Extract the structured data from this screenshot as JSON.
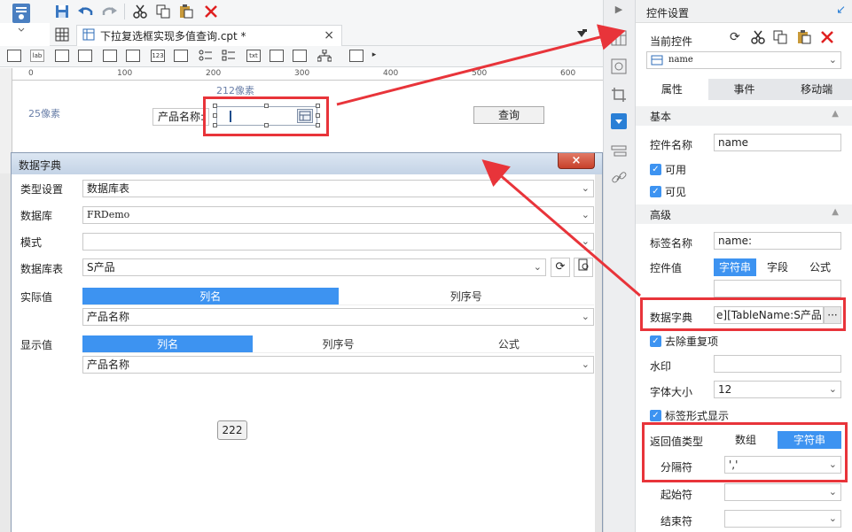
{
  "toolbar": {
    "icons": [
      "save-icon",
      "undo-icon",
      "redo-icon",
      "cut-icon",
      "copy-icon",
      "paste-icon",
      "delete-icon"
    ]
  },
  "tab": {
    "title": "下拉复选框实现多值查询.cpt *",
    "close": "×"
  },
  "widget_bar": {
    "items": [
      "lab",
      "123",
      "txt"
    ]
  },
  "ruler": {
    "marks": [
      "0",
      "100",
      "200",
      "300",
      "400",
      "500",
      "600"
    ]
  },
  "canvas": {
    "width_label": "212像素",
    "height_label": "25像素",
    "field_label": "产品名称:",
    "query_button": "查询"
  },
  "dialog": {
    "title": "数据字典",
    "close": "×",
    "type_label": "类型设置",
    "type_value": "数据库表",
    "db_label": "数据库",
    "db_value": "FRDemo",
    "schema_label": "模式",
    "schema_value": "",
    "table_label": "数据库表",
    "table_value": "S产品",
    "actual_label": "实际值",
    "actual_tabs": [
      "列名",
      "列序号"
    ],
    "actual_value": "产品名称",
    "display_label": "显示值",
    "display_tabs": [
      "列名",
      "列序号",
      "公式"
    ],
    "display_value": "产品名称",
    "badge": "222"
  },
  "panel": {
    "title": "控件设置",
    "current_widget_label": "当前控件",
    "current_widget_value": "name",
    "tabs": [
      "属性",
      "事件",
      "移动端"
    ],
    "basic_section": "基本",
    "widget_name_label": "控件名称",
    "widget_name_value": "name",
    "enabled_label": "可用",
    "visible_label": "可见",
    "advanced_section": "高级",
    "tag_name_label": "标签名称",
    "tag_name_value": "name:",
    "widget_value_label": "控件值",
    "value_types": [
      "字符串",
      "字段",
      "公式"
    ],
    "dict_label": "数据字典",
    "dict_value": "e][TableName:S产品]",
    "dict_more": "···",
    "dedupe_label": "去除重复项",
    "watermark_label": "水印",
    "font_size_label": "字体大小",
    "font_size_value": "12",
    "tag_display_label": "标签形式显示",
    "return_type_label": "返回值类型",
    "return_types": [
      "数组",
      "字符串"
    ],
    "delimiter_label": "分隔符",
    "delimiter_value": "','",
    "start_label": "起始符",
    "start_value": "",
    "end_label": "结束符",
    "end_value": ""
  },
  "colors": {
    "accent": "#3d93f1",
    "highlight_red": "#e8343a",
    "delete_red": "#e02020"
  }
}
